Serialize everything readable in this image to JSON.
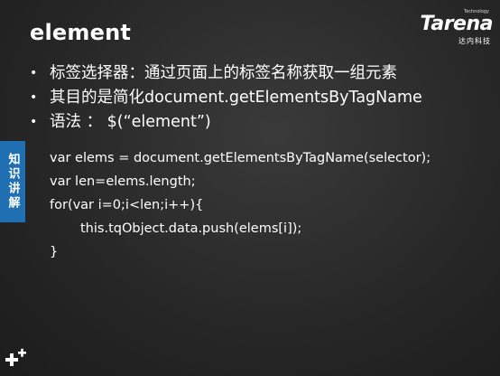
{
  "slide": {
    "title": "element",
    "logo": {
      "brand": "Tarena",
      "tag": "Technology",
      "subtitle": "达内科技"
    },
    "bullets": [
      "标签选择器：通过页面上的标签名称获取一组元素",
      "其目的是简化document.getElementsByTagName",
      "语法 ： $(“element”)"
    ],
    "code": [
      "var elems = document.getElementsByTagName(selector);",
      "var len=elems.length;",
      "for(var i=0;i<len;i++){",
      "this.tqObject.data.push(elems[i]);",
      "}"
    ],
    "side_tab": "知识讲解",
    "colors": {
      "background": "#2a2a2a",
      "side_tab": "#1f6fb2",
      "text": "#ffffff"
    }
  }
}
